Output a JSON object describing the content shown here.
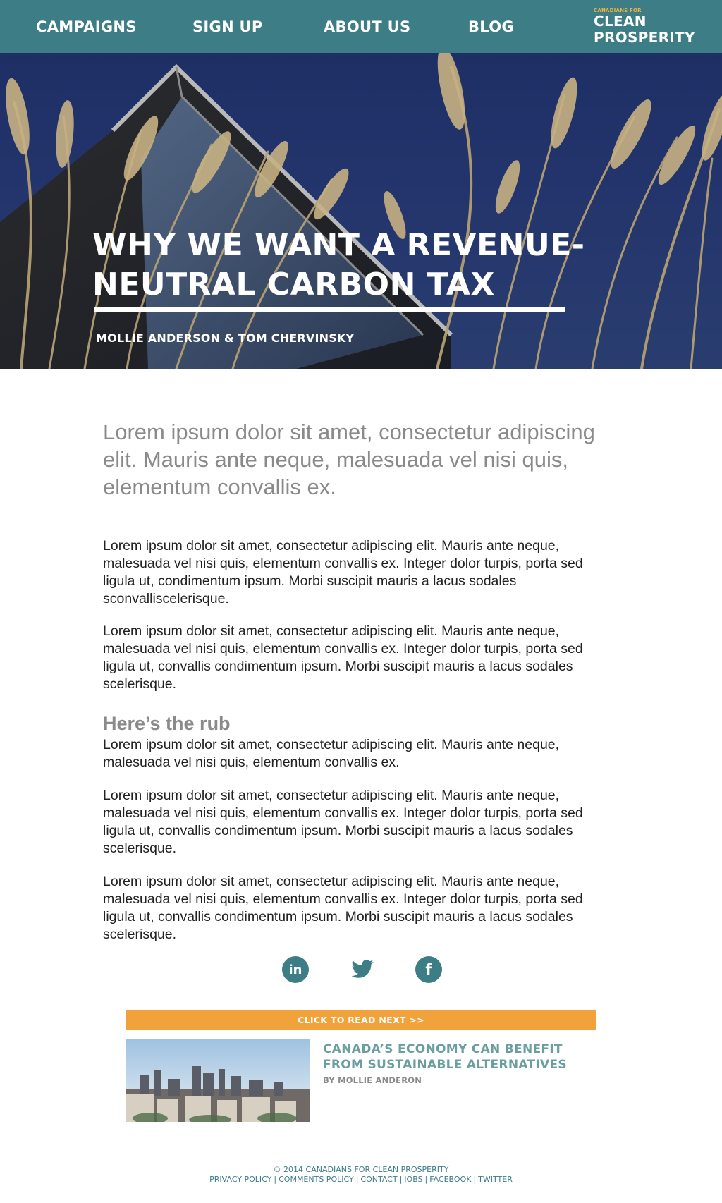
{
  "nav": {
    "items": [
      "CAMPAIGNS",
      "SIGN UP",
      "ABOUT US",
      "BLOG"
    ],
    "logo_small": "CANADIANS FOR",
    "logo_line1": "CLEAN",
    "logo_line2": "PROSPERITY"
  },
  "hero": {
    "title": "WHY WE WANT A REVENUE-NEUTRAL CARBON TAX",
    "author": "MOLLIE ANDERSON & TOM CHERVINSKY"
  },
  "article": {
    "lead": "Lorem ipsum dolor sit amet, consectetur adipiscing elit. Mauris ante neque, malesuada vel nisi quis, elementum convallis ex.",
    "paragraphs": [
      "Lorem ipsum dolor sit amet, consectetur adipiscing elit. Mauris ante neque, malesuada vel nisi quis, elementum convallis ex. Integer dolor turpis, porta sed ligula ut, condimentum ipsum. Morbi suscipit mauris a lacus sodales sconvalliscelerisque.",
      "Lorem ipsum dolor sit amet, consectetur adipiscing elit. Mauris ante neque, malesuada vel nisi quis, elementum convallis ex. Integer dolor turpis, porta sed ligula ut, convallis condimentum ipsum. Morbi suscipit mauris a lacus sodales scelerisque.",
      "Lorem ipsum dolor sit amet, consectetur adipiscing elit. Mauris ante neque, malesuada vel nisi quis, elementum convallis ex.",
      "Lorem ipsum dolor sit amet, consectetur adipiscing elit. Mauris ante neque, malesuada vel nisi quis, elementum convallis ex. Integer dolor turpis, porta sed ligula ut, convallis condimentum ipsum. Morbi suscipit mauris a lacus sodales scelerisque.",
      "Lorem ipsum dolor sit amet, consectetur adipiscing elit. Mauris ante neque, malesuada vel nisi quis, elementum convallis ex. Integer dolor turpis, porta sed ligula ut, convallis condimentum ipsum. Morbi suscipit mauris a lacus sodales scelerisque."
    ],
    "subheading": "Here’s the rub"
  },
  "social": {
    "icons": [
      "linkedin-icon",
      "twitter-icon",
      "facebook-icon"
    ],
    "linkedin_glyph": "in",
    "facebook_glyph": "f"
  },
  "read_next": {
    "bar_label": "CLICK TO READ NEXT >>",
    "title": "CANADA’S ECONOMY CAN BENEFIT FROM SUSTAINABLE ALTERNATIVES",
    "byline": "BY MOLLIE ANDERON"
  },
  "footer": {
    "copyright": "© 2014 CANADIANS FOR CLEAN PROSPERITY",
    "links": [
      "PRIVACY POLICY",
      "COMMENTS POLICY",
      "CONTACT",
      "JOBS",
      "FACEBOOK",
      "TWITTER"
    ]
  },
  "colors": {
    "brand_teal": "#3d7d86",
    "accent_orange": "#f2a23b",
    "logo_yellow": "#f2b33d",
    "headline_green": "#6a9e9f",
    "muted_gray": "#8a8a8a"
  }
}
